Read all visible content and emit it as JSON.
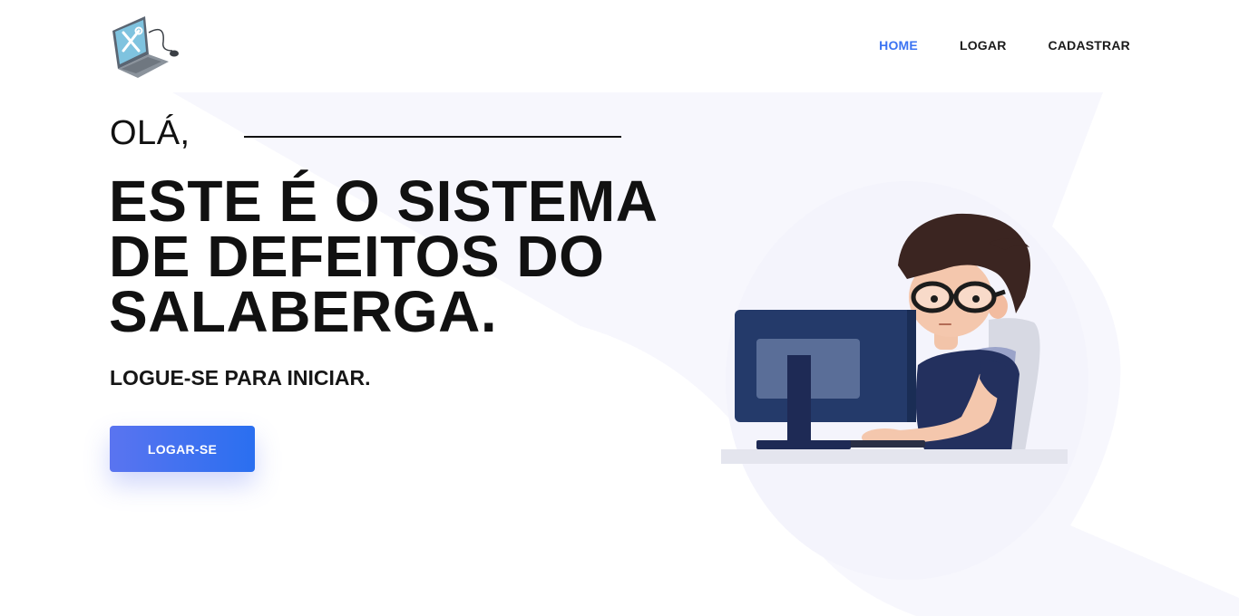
{
  "nav": {
    "items": [
      {
        "label": "HOME",
        "active": true
      },
      {
        "label": "LOGAR",
        "active": false
      },
      {
        "label": "CADASTRAR",
        "active": false
      }
    ]
  },
  "hero": {
    "greeting": "OLÁ,",
    "headline": "ESTE É O SISTEMA DE DEFEITOS DO SALABERGA.",
    "subtitle": "LOGUE-SE PARA INICIAR.",
    "cta_label": "LOGAR-SE"
  },
  "colors": {
    "accent": "#3b73f2",
    "button_start": "#5a74f0",
    "button_end": "#2a6ff0",
    "background_shape": "#f7f7fd",
    "text": "#111111"
  },
  "icons": {
    "logo": "laptop-tools-icon",
    "illustration": "developer-at-computer-illustration"
  }
}
